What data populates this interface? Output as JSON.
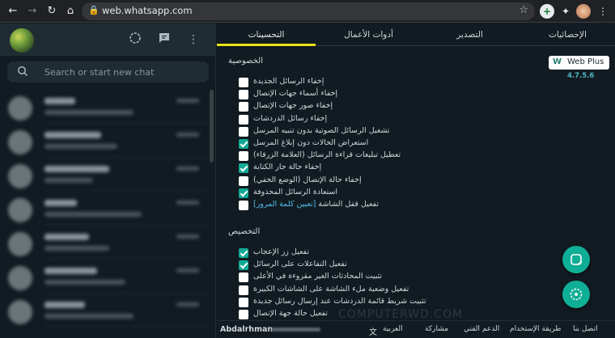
{
  "browser": {
    "url": "web.whatsapp.com"
  },
  "sidebar": {
    "search_placeholder": "Search or start new chat"
  },
  "panel": {
    "tabs": [
      {
        "label": "الإحصائيات"
      },
      {
        "label": "التصدير"
      },
      {
        "label": "أدوات الأعمال"
      },
      {
        "label": "التحسينات"
      }
    ],
    "active_tab": "التحسينات",
    "logo_text": "Web Plus",
    "version": "4.7.5.6",
    "privacy": {
      "title": "الخصوصية",
      "options": [
        {
          "label": "إخفاء الرسائل الجديدة",
          "checked": false
        },
        {
          "label": "إخفاء أسماء جهات الإتصال",
          "checked": false
        },
        {
          "label": "إخفاء صور جهات الإتصال",
          "checked": false
        },
        {
          "label": "إخفاء رسائل الدردشات",
          "checked": false
        },
        {
          "label": "تشغيل الرسائل الصوتية بدون تنبيه المرسل",
          "checked": false
        },
        {
          "label": "استعراض الحالات دون إبلاغ المرسل",
          "checked": true
        },
        {
          "label": "تعطيل تبليغات قراءة الرسائل (العلامة الزرقاء)",
          "checked": false
        },
        {
          "label": "إخفاء حالة جار الكتابة",
          "checked": true
        },
        {
          "label": "إخفاء حالة الإتصال (الوضع الخفي)",
          "checked": false
        },
        {
          "label": "استعادة الرسائل المحذوفة",
          "checked": true
        },
        {
          "label": "تفعيل قفل الشاشة",
          "link": "[تعيين كلمة المرور]",
          "checked": false
        }
      ]
    },
    "customization": {
      "title": "التخصيص",
      "options": [
        {
          "label": "تفعيل زر الإعجاب",
          "checked": true
        },
        {
          "label": "تفعيل التفاعلات على الرسائل",
          "checked": true
        },
        {
          "label": "تثبيت المحادثات الغير مقروءة في الأعلى",
          "checked": false
        },
        {
          "label": "تفعيل وضعية ملء الشاشة على الشاشات الكبيرة",
          "checked": false
        },
        {
          "label": "تثبيت شريط قائمة الدردشات عند إرسال رسائل جديدة",
          "checked": false
        },
        {
          "label": "تفعيل حالة جهة الإتصال",
          "checked": false
        }
      ]
    },
    "watermark": "COMPUTERWD.COM"
  },
  "footer": {
    "user": "Abdalrhman",
    "links": [
      {
        "label": "اتصل بنا"
      },
      {
        "label": "طريقة الإستخدام"
      },
      {
        "label": "الدعم الفني"
      },
      {
        "label": "مشاركة"
      },
      {
        "label": "العربية"
      }
    ]
  },
  "colors": {
    "accent": "#0fae96",
    "tab_underline": "#e8e21a",
    "link": "#53bdeb",
    "background": "#111b21"
  }
}
